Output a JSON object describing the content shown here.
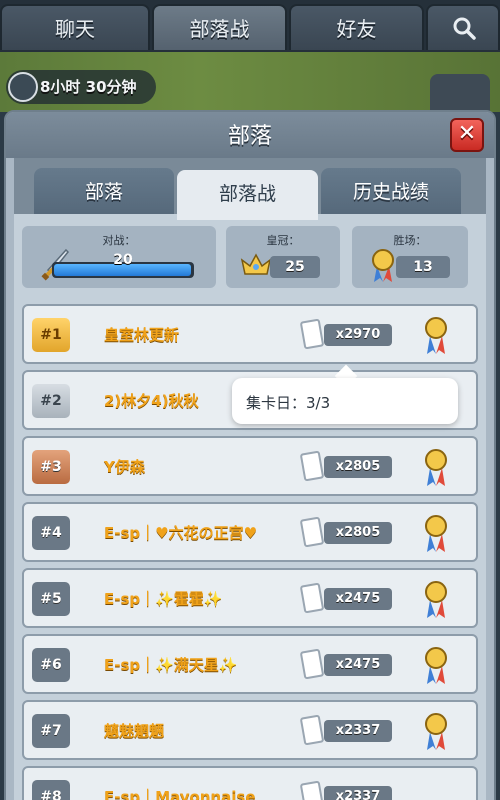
{
  "nav": {
    "tabs": [
      {
        "label": "聊天"
      },
      {
        "label": "部落战"
      },
      {
        "label": "好友"
      }
    ],
    "search_icon": "search-icon"
  },
  "timer": {
    "text": "8小时 30分钟"
  },
  "panel": {
    "title": "部落",
    "close_label": "✕"
  },
  "subtabs": [
    {
      "label": "部落"
    },
    {
      "label": "部落战"
    },
    {
      "label": "历史战绩"
    }
  ],
  "stats": {
    "battle_label": "对战：",
    "battle_value": "20",
    "battle_progress": 0.99,
    "crown_label": "皇冠：",
    "crown_value": "25",
    "wins_label": "胜场：",
    "wins_value": "13"
  },
  "tooltip": {
    "text": "集卡日：3/3"
  },
  "rows": [
    {
      "rank": "#1",
      "name": "皇室林更新",
      "score": "x2970"
    },
    {
      "rank": "#2",
      "name": "2)林夕4)秋秋",
      "score": ""
    },
    {
      "rank": "#3",
      "name": "Y伊森",
      "score": "x2805"
    },
    {
      "rank": "#4",
      "name": "E-sp｜♥六花の正宫♥",
      "score": "x2805"
    },
    {
      "rank": "#5",
      "name": "E-sp｜✨霍霍✨",
      "score": "x2475"
    },
    {
      "rank": "#6",
      "name": "E-sp｜✨满天星✨",
      "score": "x2475"
    },
    {
      "rank": "#7",
      "name": "魑魅魍魉",
      "score": "x2337"
    },
    {
      "rank": "#8",
      "name": "E-sp｜Mayonnaise",
      "score": "x2337"
    }
  ],
  "colors": {
    "accent": "#f0a21a",
    "close": "#e0433b",
    "bar": "#3a96ee"
  }
}
